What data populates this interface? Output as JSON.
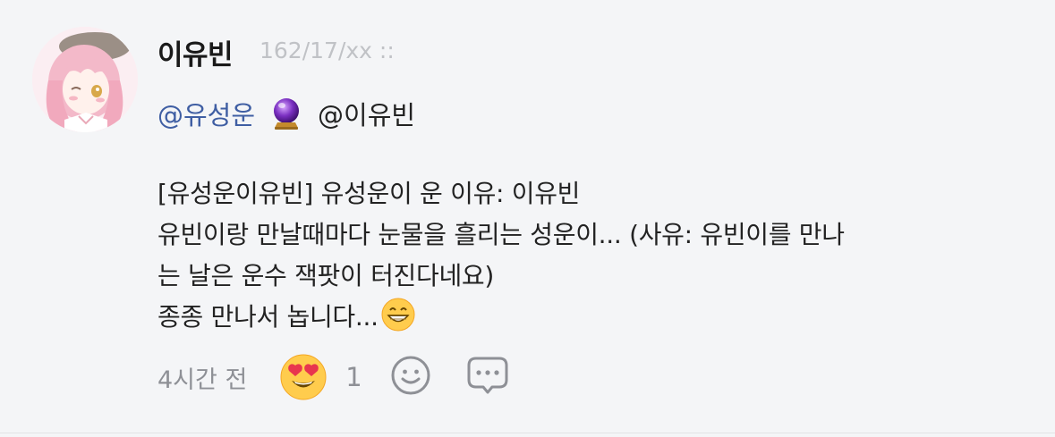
{
  "post": {
    "author_name": "이유빈",
    "author_meta": "162/17/xx ::",
    "mention_primary": "@유성운",
    "mention_icon": "crystal-ball-emoji",
    "mention_secondary": "@이유빈",
    "body_lines": [
      "[유성운이유빈] 유성운이 운 이유: 이유빈",
      "유빈이랑 만날때마다 눈물을 흘리는 성운이... (사유: 유빈이를 만나",
      "는 날은 운수 잭팟이 터진다네요)",
      "종종 만나서 놉니다..."
    ],
    "body_end_emoji": "grinning-face-emoji",
    "timestamp": "4시간 전",
    "reaction": {
      "emoji": "heart-eyes-emoji",
      "count": "1"
    },
    "accent_color": "#3f5ea3"
  }
}
